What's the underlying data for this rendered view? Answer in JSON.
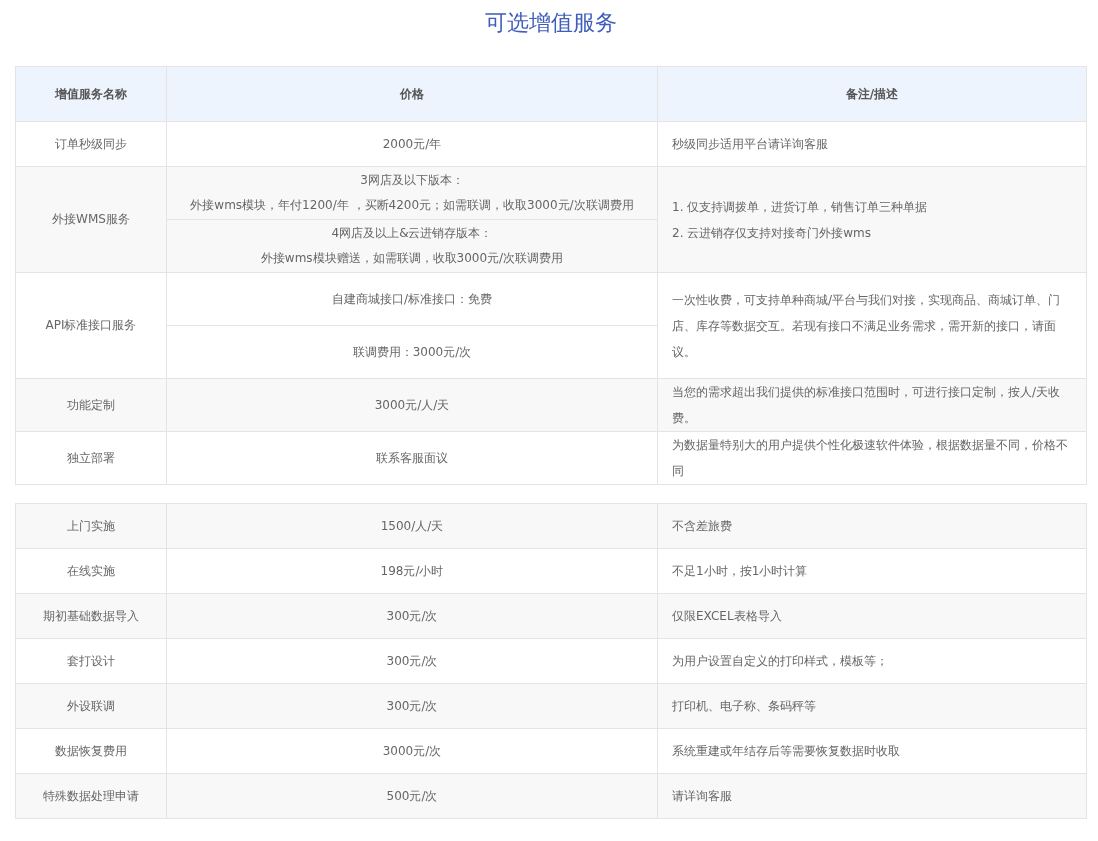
{
  "title": "可选增值服务",
  "tables": [
    {
      "columns": [
        "增值服务名称",
        "价格",
        "备注/描述"
      ],
      "rows": [
        {
          "name": "订单秒级同步",
          "prices": [
            [
              "2000元/年"
            ]
          ],
          "notes": [
            "秒级同步适用平台请详询客服"
          ]
        },
        {
          "name": "外接WMS服务",
          "prices": [
            [
              "3网店及以下版本：",
              "外接wms模块，年付1200/年 ，买断4200元；如需联调，收取3000元/次联调费用"
            ],
            [
              "4网店及以上&云进销存版本：",
              "外接wms模块赠送，如需联调，收取3000元/次联调费用"
            ]
          ],
          "notes": [
            "1. 仅支持调拨单，进货订单，销售订单三种单据",
            "2. 云进销存仅支持对接奇门外接wms"
          ]
        },
        {
          "name": "API标准接口服务",
          "prices": [
            [
              "自建商城接口/标准接口：免费"
            ],
            [
              "联调费用：3000元/次"
            ]
          ],
          "notes": [
            "一次性收费，可支持单种商城/平台与我们对接，实现商品、商城订单、门店、库存等数据交互。若现有接口不满足业务需求，需开新的接口，请面议。"
          ]
        },
        {
          "name": "功能定制",
          "prices": [
            [
              "3000元/人/天"
            ]
          ],
          "notes": [
            "当您的需求超出我们提供的标准接口范围时，可进行接口定制，按人/天收费。"
          ]
        },
        {
          "name": "独立部署",
          "prices": [
            [
              "联系客服面议"
            ]
          ],
          "notes": [
            "为数据量特别大的用户提供个性化极速软件体验，根据数据量不同，价格不同"
          ]
        }
      ]
    },
    {
      "rows": [
        {
          "name": "上门实施",
          "prices": [
            [
              "1500/人/天"
            ]
          ],
          "notes": [
            "不含差旅费"
          ]
        },
        {
          "name": "在线实施",
          "prices": [
            [
              "198元/小时"
            ]
          ],
          "notes": [
            "不足1小时，按1小时计算"
          ]
        },
        {
          "name": "期初基础数据导入",
          "prices": [
            [
              "300元/次"
            ]
          ],
          "notes": [
            "仅限EXCEL表格导入"
          ]
        },
        {
          "name": "套打设计",
          "prices": [
            [
              "300元/次"
            ]
          ],
          "notes": [
            "为用户设置自定义的打印样式，模板等；"
          ]
        },
        {
          "name": "外设联调",
          "prices": [
            [
              "300元/次"
            ]
          ],
          "notes": [
            "打印机、电子称、条码秤等"
          ]
        },
        {
          "name": "数据恢复费用",
          "prices": [
            [
              "3000元/次"
            ]
          ],
          "notes": [
            "系统重建或年结存后等需要恢复数据时收取"
          ]
        },
        {
          "name": "特殊数据处理申请",
          "prices": [
            [
              "500元/次"
            ]
          ],
          "notes": [
            "请详询客服"
          ]
        }
      ]
    }
  ]
}
